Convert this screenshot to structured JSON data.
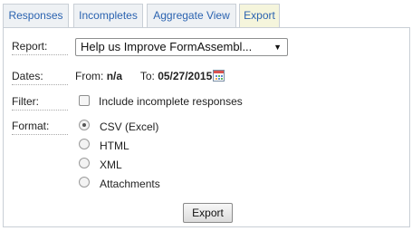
{
  "tabs": [
    {
      "label": "Responses"
    },
    {
      "label": "Incompletes"
    },
    {
      "label": "Aggregate View"
    },
    {
      "label": "Export",
      "active": true
    }
  ],
  "form": {
    "report_label": "Report:",
    "report_value": "Help us Improve FormAssembl...",
    "dates_label": "Dates:",
    "from_prefix": "From:",
    "from_value": "n/a",
    "to_prefix": "To:",
    "to_value": "05/27/2015",
    "filter_label": "Filter:",
    "filter_option": "Include incomplete responses",
    "filter_checked": false,
    "format_label": "Format:",
    "format_options": [
      {
        "label": "CSV (Excel)",
        "checked": true
      },
      {
        "label": "HTML",
        "checked": false
      },
      {
        "label": "XML",
        "checked": false
      },
      {
        "label": "Attachments",
        "checked": false
      }
    ],
    "export_button": "Export"
  },
  "icons": {
    "dropdown": "chevron-down-icon",
    "calendar": "calendar-icon"
  }
}
